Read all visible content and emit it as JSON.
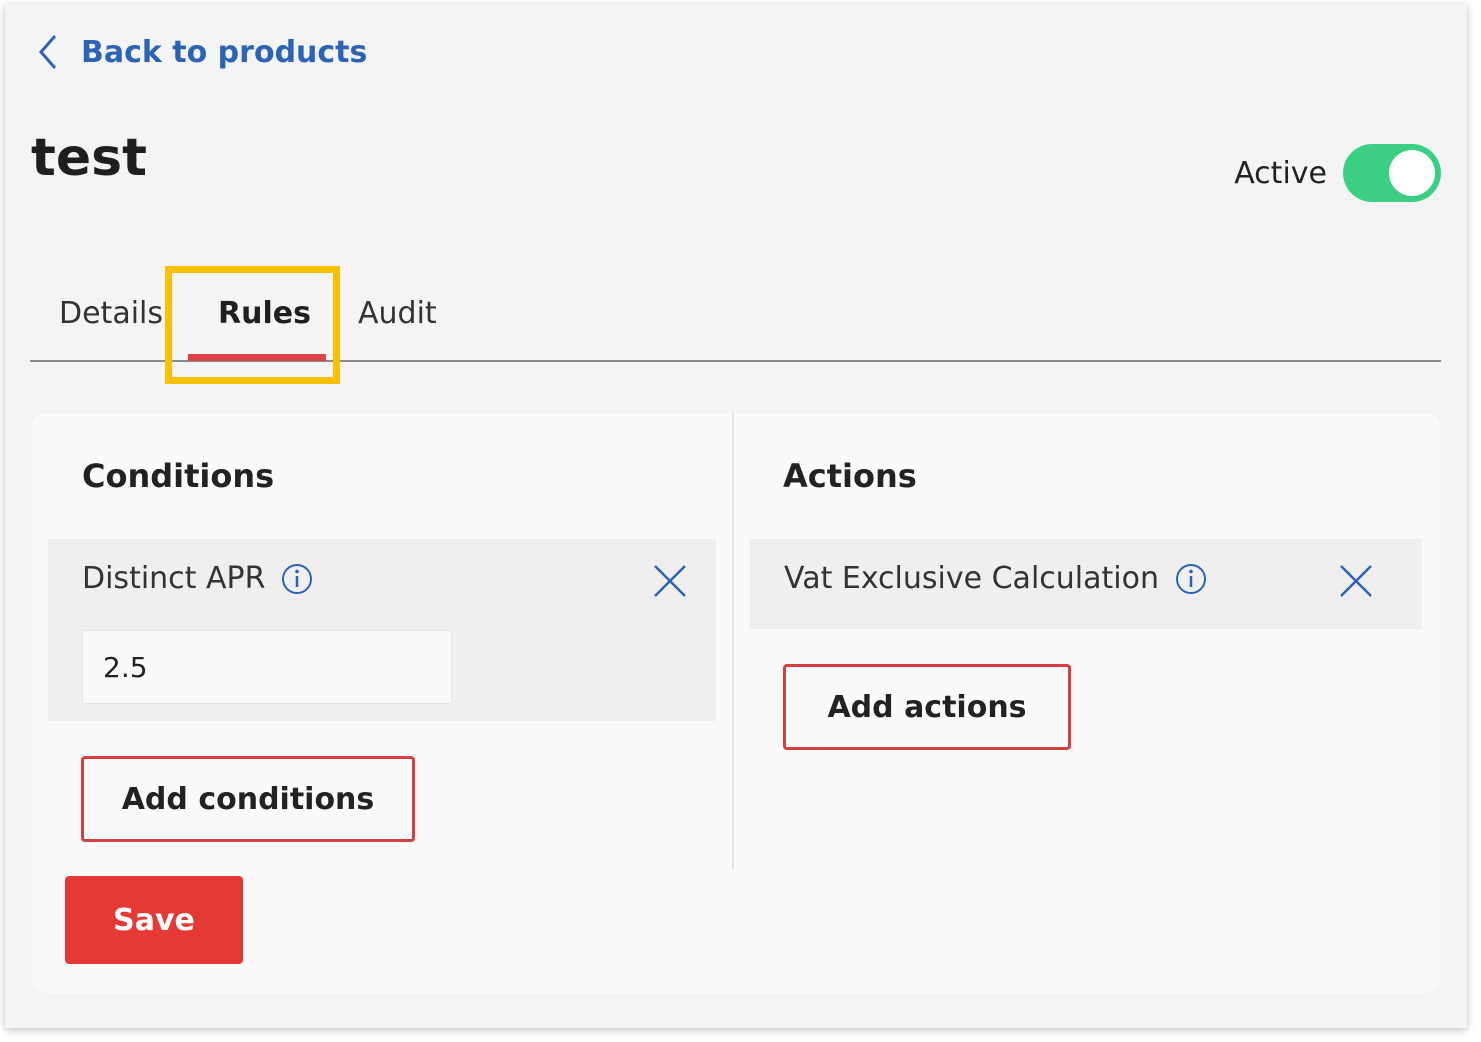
{
  "nav": {
    "back_label": "Back to products"
  },
  "header": {
    "title": "test",
    "active_label": "Active",
    "active_on": true
  },
  "tabs": [
    {
      "label": "Details",
      "selected": false
    },
    {
      "label": "Rules",
      "selected": true
    },
    {
      "label": "Audit",
      "selected": false
    }
  ],
  "conditions": {
    "title": "Conditions",
    "items": [
      {
        "label": "Distinct APR",
        "value": "2.5"
      }
    ],
    "add_label": "Add conditions"
  },
  "actions": {
    "title": "Actions",
    "items": [
      {
        "label": "Vat Exclusive Calculation"
      }
    ],
    "add_label": "Add actions"
  },
  "save_label": "Save",
  "colors": {
    "link": "#2c63b5",
    "toggle_on": "#3ccf83",
    "accent_red": "#e53935",
    "highlight": "#f5c100"
  }
}
